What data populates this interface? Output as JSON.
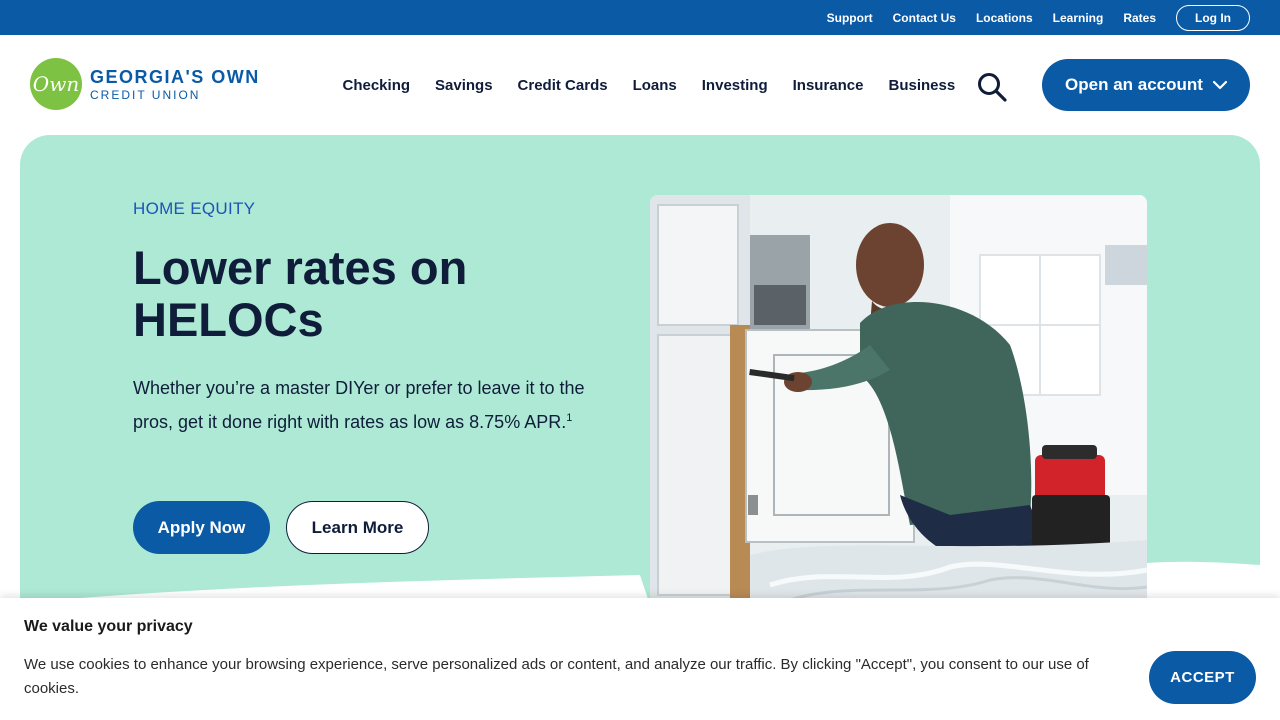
{
  "utility_nav": {
    "links": [
      "Support",
      "Contact Us",
      "Locations",
      "Learning",
      "Rates"
    ],
    "login_label": "Log In"
  },
  "brand": {
    "logo_mark": "Own",
    "name": "GEORGIA'S OWN",
    "subtitle": "CREDIT UNION"
  },
  "main_nav": {
    "items": [
      "Checking",
      "Savings",
      "Credit Cards",
      "Loans",
      "Investing",
      "Insurance",
      "Business"
    ],
    "search_icon": "search-icon",
    "open_account_label": "Open an account"
  },
  "hero": {
    "eyebrow": "HOME EQUITY",
    "title": "Lower rates on HELOCs",
    "body": "Whether you’re a master DIYer or prefer to leave it to the pros, get it done right with rates as low as 8.75% APR.",
    "footnote": "1",
    "apply_label": "Apply Now",
    "learn_label": "Learn More"
  },
  "cookie_banner": {
    "title": "We value your privacy",
    "text": "We use cookies to enhance your browsing experience, serve personalized ads or content, and analyze our traffic. By clicking \"Accept\", you consent to our use of cookies.",
    "accept_label": "ACCEPT"
  },
  "colors": {
    "brand_blue": "#0a5aa6",
    "hero_mint": "#ade9d4",
    "logo_green": "#7dc242",
    "navy_text": "#0f1d3a"
  }
}
